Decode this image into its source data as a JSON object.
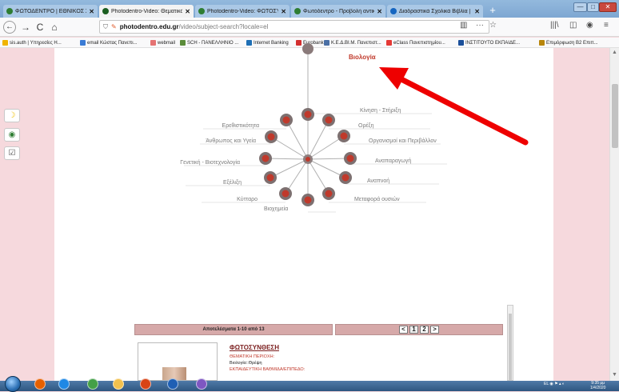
{
  "tabs": [
    {
      "label": "ΦΩΤΟΔΕΝΤΡΟ | ΕΘΝΙΚΟΣ ΣΥΣ",
      "icon": "photodentro-tab-icon",
      "color": "#2e7d32",
      "active": false
    },
    {
      "label": "Photodentro-Video: Θεματικό",
      "icon": "photodentro-tab-icon",
      "color": "#1b5e20",
      "active": true
    },
    {
      "label": "Photodentro-Video: ΦΩΤΟΣΥΝ",
      "icon": "photodentro-tab-icon",
      "color": "#2e7d32",
      "active": false
    },
    {
      "label": "Φωτόδεντρο - Προβολή αντικ",
      "icon": "photodentro-tab-icon",
      "color": "#2e7d32",
      "active": false
    },
    {
      "label": "Διαδραστικά Σχολικά Βιβλία | Ε",
      "icon": "ebooks-tab-icon",
      "color": "#1565c0",
      "active": false
    }
  ],
  "newtab_label": "+",
  "window": {
    "minimize": "—",
    "maximize": "□",
    "close": "✕"
  },
  "nav": {
    "back": "←",
    "forward": "→",
    "reload": "C",
    "home": "⌂"
  },
  "url": {
    "host": "photodentro.edu.gr",
    "path": "/video/subject-search?locale=el",
    "dots": "···",
    "library": "|||\\",
    "reader": "▥",
    "menu": "≡"
  },
  "bookmarks": [
    {
      "label": "sis.auth | Υπηρεσίες Η...",
      "color": "#f0b400"
    },
    {
      "label": "email Κώστας Πανεπι...",
      "color": "#3a7bd5"
    },
    {
      "label": "webmail",
      "color": "#e57373"
    },
    {
      "label": "SCH - ΠΑΝΕΛΛΗΝΙΟ ...",
      "color": "#5b8c3a"
    },
    {
      "label": "Internet Banking",
      "color": "#1e6fb5"
    },
    {
      "label": "Eurobank",
      "color": "#d32f2f"
    },
    {
      "label": "Κ.Ε.Δ.ΒΙ.Μ. Πανεπιστ...",
      "color": "#4a6fa5"
    },
    {
      "label": "eClass Πανεπιστημίου...",
      "color": "#e53935"
    },
    {
      "label": "ΙΝΣΤΙΤΟΥΤΟ ΕΚΠΑΙΔΕ...",
      "color": "#1a4f9a"
    },
    {
      "label": "Επιμόρφωση Β2 Επιπ...",
      "color": "#b8860b"
    }
  ],
  "wheel": {
    "top_label": "Βιολογία",
    "nodes": [
      {
        "label": "Κίνηση - Στήριξη",
        "side": "right"
      },
      {
        "label": "Ορέξη",
        "side": "right"
      },
      {
        "label": "Οργανισμοί και Περιβάλλον",
        "side": "right"
      },
      {
        "label": "Αναπαραγωγή",
        "side": "right"
      },
      {
        "label": "Αναπνοή",
        "side": "right"
      },
      {
        "label": "Μεταφορά ουσιών",
        "side": "right"
      },
      {
        "label": "Βιοχημεία",
        "side": "bottom"
      },
      {
        "label": "Κύτταρο",
        "side": "left"
      },
      {
        "label": "Εξέλιξη",
        "side": "left"
      },
      {
        "label": "Γενετική - Βιοτεχνολογία",
        "side": "left"
      },
      {
        "label": "Άνθρωπος και Υγεία",
        "side": "left"
      },
      {
        "label": "Ερεθιστικότητα",
        "side": "left"
      }
    ],
    "accent": "#c0392b"
  },
  "annotation_arrow_color": "#ee0000",
  "side_tools": {
    "moon": "☽",
    "globe": "◉",
    "check": "☑"
  },
  "results": {
    "count_label": "Αποτελέσματα 1-10 από 13",
    "pages": [
      "1",
      "2"
    ],
    "first_title": "ΦΩΤΟΣΥΝΘΕΣΗ",
    "lines": [
      {
        "text": "ΘΕΜΑΤΙΚΗ ΠΕΡΙΟΧΗ:",
        "style": "red"
      },
      {
        "text": "Βιολογία::Θρέψη",
        "style": "blk"
      },
      {
        "text": "ΕΚΠΑΙΔΕΥΤΙΚΗ ΒΑΘΜΙΔΑ/ΕΠΙΠΕΔΟ:",
        "style": "red"
      }
    ]
  },
  "taskbar": {
    "tray_text": "EL",
    "time": "9:35 μμ",
    "date": "1/4/2020",
    "apps": [
      {
        "icon": "firefox-taskbar-icon",
        "color": "#e66000"
      },
      {
        "icon": "ie-taskbar-icon",
        "color": "#1e88e5"
      },
      {
        "icon": "chrome-taskbar-icon",
        "color": "#43a047"
      },
      {
        "icon": "folder-taskbar-icon",
        "color": "#f2c14e"
      },
      {
        "icon": "powerpoint-taskbar-icon",
        "color": "#d84315"
      },
      {
        "icon": "word-taskbar-icon",
        "color": "#1e5fb4"
      },
      {
        "icon": "paint-taskbar-icon",
        "color": "#7e57c2"
      }
    ]
  }
}
